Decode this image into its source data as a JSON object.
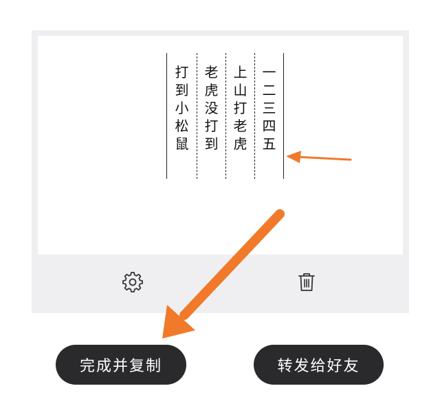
{
  "editor": {
    "columns": [
      [
        "一",
        "二",
        "三",
        "四",
        "五"
      ],
      [
        "上",
        "山",
        "打",
        "老",
        "虎"
      ],
      [
        "老",
        "虎",
        "没",
        "打",
        "到"
      ],
      [
        "打",
        "到",
        "小",
        "松",
        "鼠"
      ]
    ]
  },
  "toolbar": {
    "settings_icon": "gear-icon",
    "delete_icon": "trash-icon"
  },
  "actions": {
    "complete_copy": "完成并复制",
    "share_friend": "转发给好友"
  },
  "colors": {
    "arrow": "#f07a2a",
    "button_bg": "#2a2a2c",
    "panel_bg": "#efeff1"
  }
}
